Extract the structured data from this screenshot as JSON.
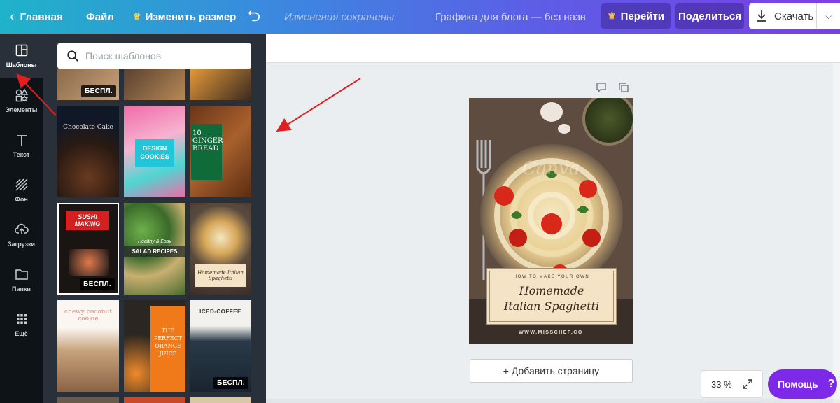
{
  "topbar": {
    "home_label": "Главная",
    "file_label": "Файл",
    "resize_label": "Изменить размер",
    "saved_status": "Изменения сохранены",
    "doc_title": "Графика для блога — без назва...",
    "upgrade_label": "Перейти",
    "share_label": "Поделиться",
    "download_label": "Скачать"
  },
  "sidebar": {
    "items": [
      {
        "label": "Шаблоны",
        "icon": "templates-icon"
      },
      {
        "label": "Элементы",
        "icon": "elements-icon"
      },
      {
        "label": "Текст",
        "icon": "text-icon"
      },
      {
        "label": "Фон",
        "icon": "background-icon"
      },
      {
        "label": "Загрузки",
        "icon": "upload-icon"
      },
      {
        "label": "Папки",
        "icon": "folder-icon"
      },
      {
        "label": "Ещё",
        "icon": "more-icon"
      }
    ]
  },
  "templates": {
    "search_placeholder": "Поиск шаблонов",
    "free_badge": "БЕСПЛ.",
    "items": [
      {
        "title": "Chocolate Cake"
      },
      {
        "title": "DESIGN COOKIES"
      },
      {
        "title": "10 GINGER BREAD"
      },
      {
        "title": "SUSHI MAKING"
      },
      {
        "title": "SALAD RECIPES",
        "subtitle": "Healthy & Easy"
      },
      {
        "title": "Homemade Italian Spaghetti"
      },
      {
        "title": "chewy coconut cookie"
      },
      {
        "title": "THE PERFECT ORANGE JUICE"
      },
      {
        "title": "ICED-COFFEE"
      }
    ]
  },
  "design": {
    "watermark": "Canva",
    "kicker": "HOW TO MAKE YOUR OWN",
    "title_line1": "Homemade",
    "title_line2": "Italian Spaghetti",
    "url": "WWW.MISSCHEF.CO"
  },
  "canvas": {
    "add_page_label": "+ Добавить страницу",
    "zoom_label": "33 %",
    "help_label": "Помощь",
    "help_mark": "?"
  },
  "colors": {
    "accent_purple": "#7d2ae8",
    "annotation_arrow": "#e02020"
  }
}
